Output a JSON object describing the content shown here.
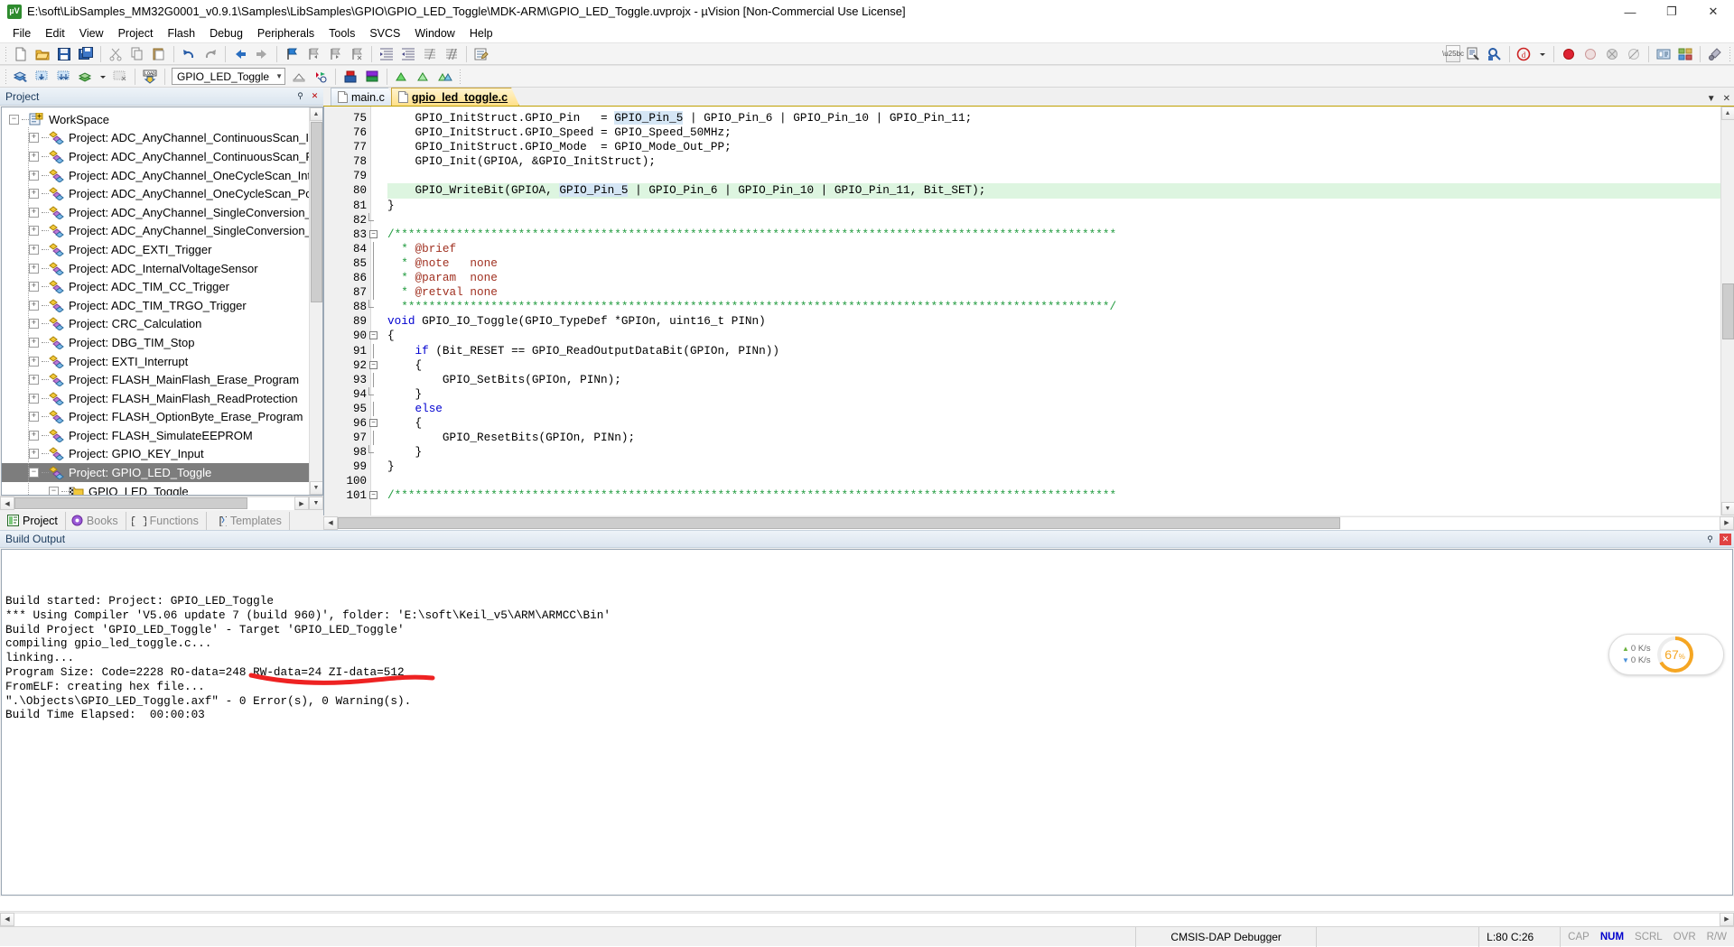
{
  "window": {
    "title": "E:\\soft\\LibSamples_MM32G0001_v0.9.1\\Samples\\LibSamples\\GPIO\\GPIO_LED_Toggle\\MDK-ARM\\GPIO_LED_Toggle.uvprojx - µVision  [Non-Commercial Use License]",
    "icon": "uvision-icon",
    "minimize": "—",
    "maximize": "❐",
    "close": "✕"
  },
  "menu": [
    "File",
    "Edit",
    "View",
    "Project",
    "Flash",
    "Debug",
    "Peripherals",
    "Tools",
    "SVCS",
    "Window",
    "Help"
  ],
  "toolbar1": [
    {
      "name": "new-file-icon"
    },
    {
      "name": "open-file-icon"
    },
    {
      "name": "save-icon"
    },
    {
      "name": "save-all-icon"
    },
    {
      "sep": true
    },
    {
      "name": "cut-icon"
    },
    {
      "name": "copy-icon"
    },
    {
      "name": "paste-icon"
    },
    {
      "sep": true
    },
    {
      "name": "undo-icon"
    },
    {
      "name": "redo-icon"
    },
    {
      "sep": true
    },
    {
      "name": "navigate-back-icon"
    },
    {
      "name": "navigate-forward-icon"
    },
    {
      "sep": true
    },
    {
      "name": "toggle-bookmark-icon"
    },
    {
      "name": "previous-bookmark-icon"
    },
    {
      "name": "next-bookmark-icon"
    },
    {
      "name": "clear-bookmarks-icon"
    },
    {
      "sep": true
    },
    {
      "name": "indent-icon"
    },
    {
      "name": "outdent-icon"
    },
    {
      "name": "comment-icon"
    },
    {
      "name": "uncomment-icon"
    },
    {
      "sep": true
    },
    {
      "name": "configuration-wizard-icon"
    }
  ],
  "toolbar1_right": [
    {
      "name": "dropdown-caret-icon"
    },
    {
      "name": "insert-template-icon"
    },
    {
      "name": "find-in-files-icon"
    },
    {
      "sep": true
    },
    {
      "name": "start-debug-icon"
    },
    {
      "name": "debug-dropdown-icon"
    },
    {
      "sep": true
    },
    {
      "name": "breakpoint-icon"
    },
    {
      "name": "breakpoint-disable-icon"
    },
    {
      "name": "breakpoint-kill-all-icon"
    },
    {
      "name": "breakpoint-disable-all-icon"
    },
    {
      "sep": true
    },
    {
      "name": "target-options-icon"
    },
    {
      "name": "manage-run-time-env-icon"
    },
    {
      "sep": true
    },
    {
      "name": "utilities-icon"
    }
  ],
  "toolbar2": [
    {
      "name": "build-icon"
    },
    {
      "name": "rebuild-icon"
    },
    {
      "name": "batch-build-icon"
    },
    {
      "name": "translate-icon"
    },
    {
      "name": "build-dropdown-icon"
    },
    {
      "name": "stop-build-icon"
    },
    {
      "sep": true
    },
    {
      "name": "download-load-icon"
    },
    {
      "sep": true
    }
  ],
  "toolbar2_target": {
    "value": "GPIO_LED_Toggle",
    "arrow": "▼"
  },
  "toolbar2_after": [
    {
      "name": "target-options-dialog-icon"
    },
    {
      "name": "manage-project-items-icon"
    },
    {
      "sep": true
    },
    {
      "name": "books-window-icon"
    },
    {
      "name": "functions-window-icon"
    },
    {
      "sep": true
    },
    {
      "name": "source-browse-icon"
    },
    {
      "name": "project-window-icon"
    },
    {
      "name": "templates-window-icon"
    }
  ],
  "project_panel": {
    "title": "Project",
    "pin_icon": "pin-icon",
    "close_icon": "close-icon",
    "tree": [
      {
        "label": "WorkSpace",
        "depth": 0,
        "expander": "−",
        "icon": "workspace-icon",
        "selected": false
      },
      {
        "label": "Project: ADC_AnyChannel_ContinuousScan_Interrupt",
        "depth": 1,
        "expander": "+",
        "icon": "project-icon",
        "selected": false
      },
      {
        "label": "Project: ADC_AnyChannel_ContinuousScan_Polling",
        "depth": 1,
        "expander": "+",
        "icon": "project-icon",
        "selected": false
      },
      {
        "label": "Project: ADC_AnyChannel_OneCycleScan_Interrupt",
        "depth": 1,
        "expander": "+",
        "icon": "project-icon",
        "selected": false
      },
      {
        "label": "Project: ADC_AnyChannel_OneCycleScan_Polling",
        "depth": 1,
        "expander": "+",
        "icon": "project-icon",
        "selected": false
      },
      {
        "label": "Project: ADC_AnyChannel_SingleConversion_Interrupt",
        "depth": 1,
        "expander": "+",
        "icon": "project-icon",
        "selected": false
      },
      {
        "label": "Project: ADC_AnyChannel_SingleConversion_Polling",
        "depth": 1,
        "expander": "+",
        "icon": "project-icon",
        "selected": false
      },
      {
        "label": "Project: ADC_EXTI_Trigger",
        "depth": 1,
        "expander": "+",
        "icon": "project-icon",
        "selected": false
      },
      {
        "label": "Project: ADC_InternalVoltageSensor",
        "depth": 1,
        "expander": "+",
        "icon": "project-icon",
        "selected": false
      },
      {
        "label": "Project: ADC_TIM_CC_Trigger",
        "depth": 1,
        "expander": "+",
        "icon": "project-icon",
        "selected": false
      },
      {
        "label": "Project: ADC_TIM_TRGO_Trigger",
        "depth": 1,
        "expander": "+",
        "icon": "project-icon",
        "selected": false
      },
      {
        "label": "Project: CRC_Calculation",
        "depth": 1,
        "expander": "+",
        "icon": "project-icon",
        "selected": false
      },
      {
        "label": "Project: DBG_TIM_Stop",
        "depth": 1,
        "expander": "+",
        "icon": "project-icon",
        "selected": false
      },
      {
        "label": "Project: EXTI_Interrupt",
        "depth": 1,
        "expander": "+",
        "icon": "project-icon",
        "selected": false
      },
      {
        "label": "Project: FLASH_MainFlash_Erase_Program",
        "depth": 1,
        "expander": "+",
        "icon": "project-icon",
        "selected": false
      },
      {
        "label": "Project: FLASH_MainFlash_ReadProtection",
        "depth": 1,
        "expander": "+",
        "icon": "project-icon",
        "selected": false
      },
      {
        "label": "Project: FLASH_OptionByte_Erase_Program",
        "depth": 1,
        "expander": "+",
        "icon": "project-icon",
        "selected": false
      },
      {
        "label": "Project: FLASH_SimulateEEPROM",
        "depth": 1,
        "expander": "+",
        "icon": "project-icon",
        "selected": false
      },
      {
        "label": "Project: GPIO_KEY_Input",
        "depth": 1,
        "expander": "+",
        "icon": "project-icon",
        "selected": false
      },
      {
        "label": "Project: GPIO_LED_Toggle",
        "depth": 1,
        "expander": "−",
        "icon": "project-icon",
        "selected": true
      },
      {
        "label": "GPIO_LED_Toggle",
        "depth": 2,
        "expander": "−",
        "icon": "target-folder-icon",
        "selected": false
      }
    ],
    "tabs": [
      {
        "label": "Project",
        "icon": "project-tab-icon",
        "active": true
      },
      {
        "label": "Books",
        "icon": "books-tab-icon",
        "active": false
      },
      {
        "label": "Functions",
        "icon": "functions-tab-icon",
        "active": false
      },
      {
        "label": "Templates",
        "icon": "templates-tab-icon",
        "active": false
      }
    ]
  },
  "editor": {
    "tabs": [
      {
        "label": "main.c",
        "icon": "source-file-icon",
        "active": false
      },
      {
        "label": "gpio_led_toggle.c",
        "icon": "source-file-icon",
        "active": true
      }
    ],
    "tabstrip_buttons": [
      {
        "name": "tabstrip-dropdown-icon",
        "glyph": "▼"
      },
      {
        "name": "tabstrip-close-icon",
        "glyph": "✕"
      }
    ],
    "first_line": 75,
    "lines": [
      {
        "n": 75,
        "fold": "",
        "hl": false,
        "segments": [
          {
            "t": "    GPIO_InitStruct.GPIO_Pin   = ",
            "c": ""
          },
          {
            "t": "GPIO_Pin_5",
            "c": "hlid"
          },
          {
            "t": " | GPIO_Pin_6 | GPIO_Pin_10 | GPIO_Pin_11;",
            "c": ""
          }
        ]
      },
      {
        "n": 76,
        "fold": "",
        "hl": false,
        "segments": [
          {
            "t": "    GPIO_InitStruct.GPIO_Speed = GPIO_Speed_50MHz;",
            "c": ""
          }
        ]
      },
      {
        "n": 77,
        "fold": "",
        "hl": false,
        "segments": [
          {
            "t": "    GPIO_InitStruct.GPIO_Mode  = GPIO_Mode_Out_PP;",
            "c": ""
          }
        ]
      },
      {
        "n": 78,
        "fold": "",
        "hl": false,
        "segments": [
          {
            "t": "    GPIO_Init(GPIOA, &GPIO_InitStruct);",
            "c": ""
          }
        ]
      },
      {
        "n": 79,
        "fold": "",
        "hl": false,
        "segments": [
          {
            "t": "",
            "c": ""
          }
        ]
      },
      {
        "n": 80,
        "fold": "",
        "hl": true,
        "segments": [
          {
            "t": "    GPIO_WriteBit(GPIOA, ",
            "c": ""
          },
          {
            "t": "GPIO_Pin_5",
            "c": "hlid"
          },
          {
            "t": " | GPIO_Pin_6 | GPIO_Pin_10 | GPIO_Pin_11, Bit_SET);",
            "c": ""
          }
        ]
      },
      {
        "n": 81,
        "fold": "",
        "hl": false,
        "segments": [
          {
            "t": "}",
            "c": ""
          }
        ]
      },
      {
        "n": 82,
        "fold": "end",
        "hl": false,
        "segments": [
          {
            "t": "",
            "c": ""
          }
        ]
      },
      {
        "n": 83,
        "fold": "minus",
        "hl": false,
        "segments": [
          {
            "t": "/*********************************************************************************************************",
            "c": "cm"
          }
        ]
      },
      {
        "n": 84,
        "fold": "line",
        "hl": false,
        "segments": [
          {
            "t": "  * ",
            "c": "cm"
          },
          {
            "t": "@brief",
            "c": "doc"
          }
        ]
      },
      {
        "n": 85,
        "fold": "line",
        "hl": false,
        "segments": [
          {
            "t": "  * ",
            "c": "cm"
          },
          {
            "t": "@note",
            "c": "doc"
          },
          {
            "t": "   none",
            "c": "doc"
          }
        ]
      },
      {
        "n": 86,
        "fold": "line",
        "hl": false,
        "segments": [
          {
            "t": "  * ",
            "c": "cm"
          },
          {
            "t": "@param",
            "c": "doc"
          },
          {
            "t": "  none",
            "c": "doc"
          }
        ]
      },
      {
        "n": 87,
        "fold": "line",
        "hl": false,
        "segments": [
          {
            "t": "  * ",
            "c": "cm"
          },
          {
            "t": "@retval",
            "c": "doc"
          },
          {
            "t": " none",
            "c": "doc"
          }
        ]
      },
      {
        "n": 88,
        "fold": "end",
        "hl": false,
        "segments": [
          {
            "t": "  *******************************************************************************************************/",
            "c": "cm"
          }
        ]
      },
      {
        "n": 89,
        "fold": "",
        "hl": false,
        "segments": [
          {
            "t": "void",
            "c": "kw"
          },
          {
            "t": " GPIO_IO_Toggle(GPIO_TypeDef *GPIOn, uint16_t PINn)",
            "c": ""
          }
        ]
      },
      {
        "n": 90,
        "fold": "minus",
        "hl": false,
        "segments": [
          {
            "t": "{",
            "c": ""
          }
        ]
      },
      {
        "n": 91,
        "fold": "line",
        "hl": false,
        "segments": [
          {
            "t": "    ",
            "c": ""
          },
          {
            "t": "if",
            "c": "kw"
          },
          {
            "t": " (Bit_RESET == GPIO_ReadOutputDataBit(GPIOn, PINn))",
            "c": ""
          }
        ]
      },
      {
        "n": 92,
        "fold": "minus",
        "hl": false,
        "segments": [
          {
            "t": "    {",
            "c": ""
          }
        ]
      },
      {
        "n": 93,
        "fold": "line",
        "hl": false,
        "segments": [
          {
            "t": "        GPIO_SetBits(GPIOn, PINn);",
            "c": ""
          }
        ]
      },
      {
        "n": 94,
        "fold": "end",
        "hl": false,
        "segments": [
          {
            "t": "    }",
            "c": ""
          }
        ]
      },
      {
        "n": 95,
        "fold": "line",
        "hl": false,
        "segments": [
          {
            "t": "    ",
            "c": ""
          },
          {
            "t": "else",
            "c": "kw"
          }
        ]
      },
      {
        "n": 96,
        "fold": "minus",
        "hl": false,
        "segments": [
          {
            "t": "    {",
            "c": ""
          }
        ]
      },
      {
        "n": 97,
        "fold": "line",
        "hl": false,
        "segments": [
          {
            "t": "        GPIO_ResetBits(GPIOn, PINn);",
            "c": ""
          }
        ]
      },
      {
        "n": 98,
        "fold": "end",
        "hl": false,
        "segments": [
          {
            "t": "    }",
            "c": ""
          }
        ]
      },
      {
        "n": 99,
        "fold": "",
        "hl": false,
        "segments": [
          {
            "t": "}",
            "c": ""
          }
        ]
      },
      {
        "n": 100,
        "fold": "",
        "hl": false,
        "segments": [
          {
            "t": "",
            "c": ""
          }
        ]
      },
      {
        "n": 101,
        "fold": "minus",
        "hl": false,
        "segments": [
          {
            "t": "/*********************************************************************************************************",
            "c": "cm"
          }
        ]
      }
    ]
  },
  "build_output": {
    "title": "Build Output",
    "pin_icon": "pin-icon",
    "close_icon": "close-icon",
    "lines": [
      "Build started: Project: GPIO_LED_Toggle",
      "*** Using Compiler 'V5.06 update 7 (build 960)', folder: 'E:\\soft\\Keil_v5\\ARM\\ARMCC\\Bin'",
      "Build Project 'GPIO_LED_Toggle' - Target 'GPIO_LED_Toggle'",
      "compiling gpio_led_toggle.c...",
      "linking...",
      "Program Size: Code=2228 RO-data=248 RW-data=24 ZI-data=512",
      "FromELF: creating hex file...",
      "\".\\Objects\\GPIO_LED_Toggle.axf\" - 0 Error(s), 0 Warning(s).",
      "Build Time Elapsed:  00:00:03"
    ],
    "annotation_color": "#ee2222"
  },
  "net_widget": {
    "upload": "0 K/s",
    "download": "0 K/s",
    "up_arrow": "▲",
    "down_arrow": "▼",
    "cpu_value": "67",
    "cpu_unit": "%",
    "cpu_color": "#f5a623"
  },
  "statusbar": {
    "debugger": "CMSIS-DAP Debugger",
    "cursor": "L:80 C:26",
    "indicators": [
      {
        "label": "CAP",
        "state": "off"
      },
      {
        "label": "NUM",
        "state": "on"
      },
      {
        "label": "SCRL",
        "state": "off"
      },
      {
        "label": "OVR",
        "state": "off"
      },
      {
        "label": "R/W",
        "state": "off"
      }
    ]
  }
}
